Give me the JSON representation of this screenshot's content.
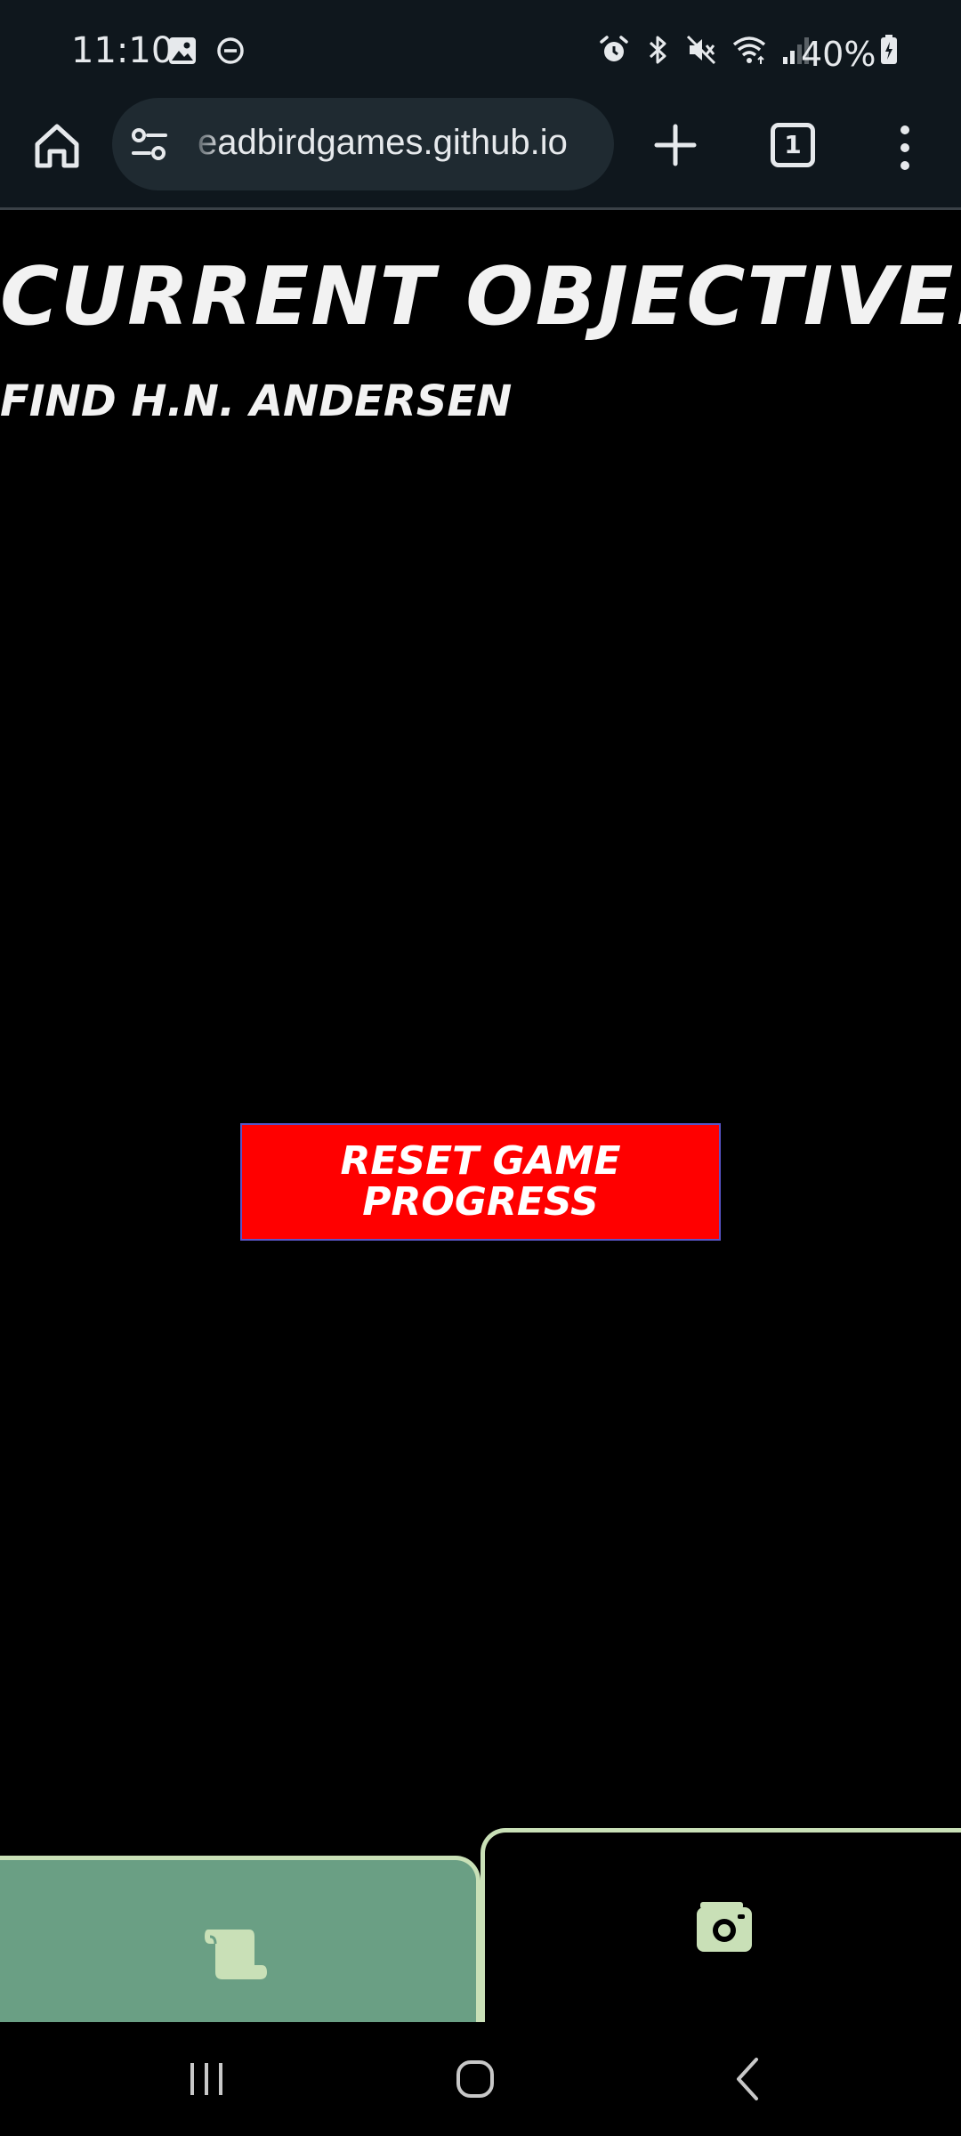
{
  "status_bar": {
    "time": "11:10",
    "battery": "40%",
    "left_icons": [
      "image-icon",
      "dnd-icon"
    ],
    "right_icons": [
      "alarm-icon",
      "bluetooth-icon",
      "mute-icon",
      "wifi-icon",
      "signal-icon",
      "battery-icon"
    ]
  },
  "browser": {
    "url": "deadbirdgames.github.io",
    "url_visible": "eadbirdgames.github.io",
    "tab_count": "1"
  },
  "page": {
    "objective_title": "Current Objective:",
    "objective_text": "Find H.N. Andersen",
    "reset_button": "Reset Game Progress"
  },
  "bottom_tabs": [
    {
      "name": "journal",
      "icon": "scroll-icon",
      "active": false
    },
    {
      "name": "camera",
      "icon": "camera-icon",
      "active": true
    }
  ],
  "colors": {
    "reset_button": "#ff0000",
    "tab_active_fill": "#6a9f84",
    "tab_border": "#c9e0b7",
    "chrome_bg": "#0f171d"
  }
}
